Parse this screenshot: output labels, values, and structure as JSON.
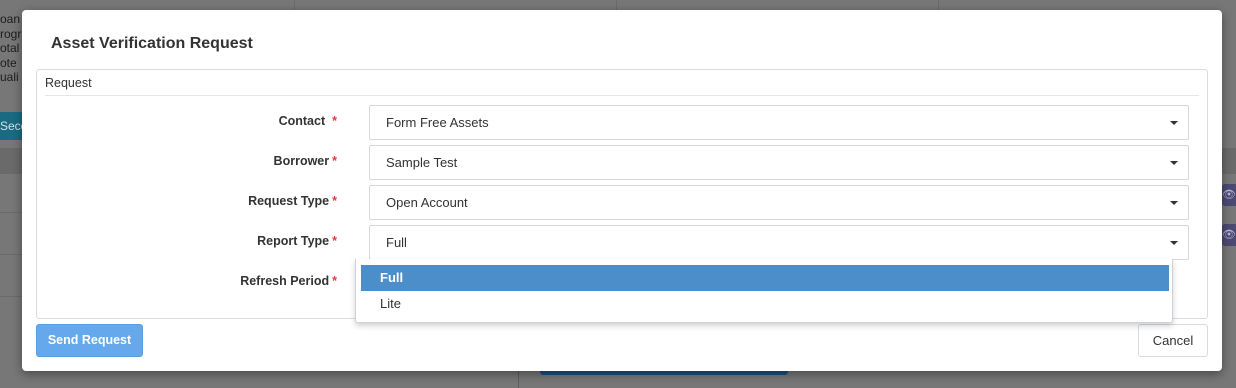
{
  "background": {
    "side_text": [
      "oan",
      "rogr",
      "otal",
      "ote",
      "uali"
    ],
    "side_button": "Seco",
    "eye_icon": "eye-icon"
  },
  "modal": {
    "title": "Asset Verification Request",
    "fieldset_legend": "Request",
    "required_marker": "*",
    "fields": [
      {
        "label": "Contact",
        "value": "Form Free Assets"
      },
      {
        "label": "Borrower",
        "value": "Sample Test"
      },
      {
        "label": "Request Type",
        "value": "Open Account"
      },
      {
        "label": "Report Type",
        "value": "Full"
      },
      {
        "label": "Refresh Period",
        "value": ""
      }
    ],
    "dropdown": {
      "options": [
        "Full",
        "Lite"
      ],
      "selected": "Full"
    },
    "send_button": "Send Request",
    "cancel_button": "Cancel"
  },
  "colors": {
    "primary": "#65a8ec",
    "highlight": "#4c8ec9",
    "required": "#e03b3b"
  }
}
